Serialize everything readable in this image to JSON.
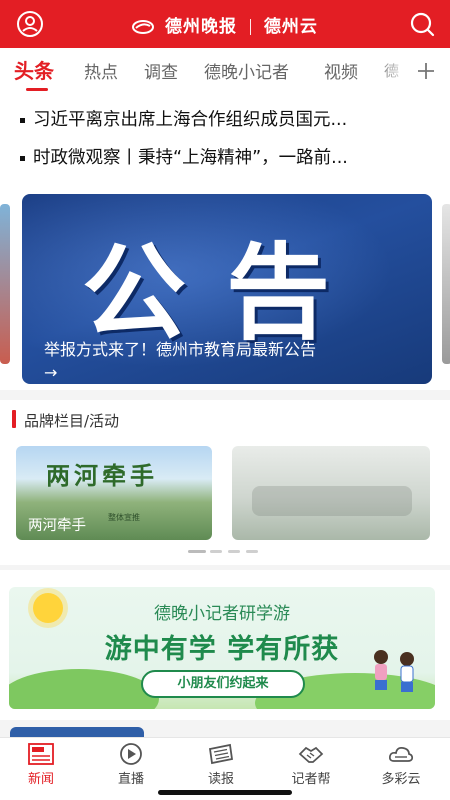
{
  "header": {
    "brand_name": "德州晚报",
    "brand_sub": "德州云",
    "icons": {
      "left": "user-icon",
      "right": "search-icon"
    },
    "colors": {
      "primary": "#e31e24"
    }
  },
  "tabs": [
    {
      "label": "头条",
      "active": true
    },
    {
      "label": "热点"
    },
    {
      "label": "调查"
    },
    {
      "label": "德晚小记者"
    },
    {
      "label": "视频"
    },
    {
      "label": "德"
    }
  ],
  "tabs_add_icon": "plus-icon",
  "headlines": [
    "习近平离京出席上海合作组织成员国元...",
    "时政微观察丨秉持“上海精神”，一路前..."
  ],
  "banner": {
    "big_text": "公告",
    "caption": "举报方式来了！德州市教育局最新公告",
    "arrow": "→"
  },
  "brand_section": {
    "title": "品牌栏目/活动",
    "cards": [
      {
        "art_text": "两河牵手",
        "sub_text": "整体宣推",
        "label": "两河牵手"
      },
      {
        "label": ""
      }
    ],
    "carousel": {
      "count": 4,
      "active_index": 0
    }
  },
  "promo": {
    "line1": "德晚小记者研学游",
    "line2": "游中有学 学有所获",
    "pill": "小朋友们约起来"
  },
  "bottom_nav": [
    {
      "label": "新闻",
      "icon": "news-icon",
      "active": true
    },
    {
      "label": "直播",
      "icon": "live-play-icon"
    },
    {
      "label": "读报",
      "icon": "newspaper-icon"
    },
    {
      "label": "记者帮",
      "icon": "handshake-icon"
    },
    {
      "label": "多彩云",
      "icon": "cloud-icon"
    }
  ]
}
